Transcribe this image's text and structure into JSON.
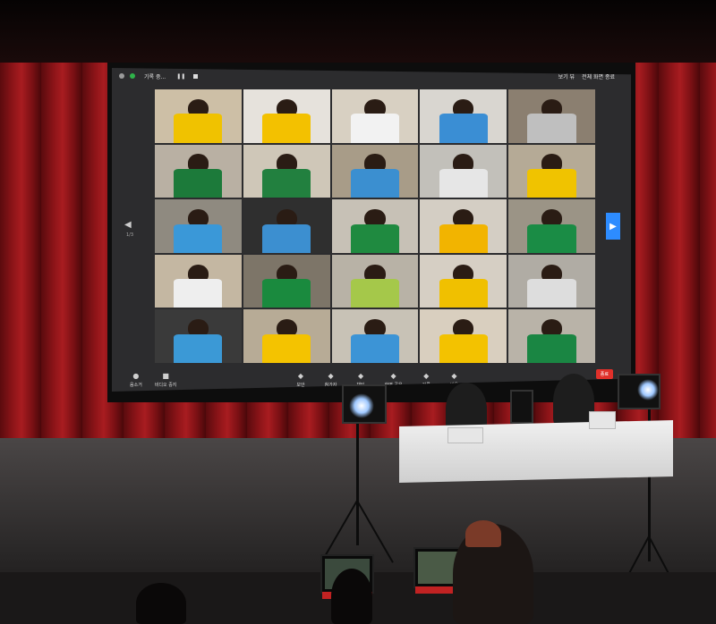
{
  "zoom": {
    "topbar": {
      "recording_label": "기록 중...",
      "right_label_1": "보기 뷰",
      "right_label_2": "전체 화면 종료"
    },
    "pager": {
      "left_arrow": "◀",
      "page": "1/3",
      "right_arrow": "▶"
    },
    "bottombar": {
      "audio_label": "음소거",
      "video_label": "비디오 중지",
      "center_items": [
        "보안",
        "참가자",
        "채팅",
        "화면 공유",
        "기록",
        "반응"
      ],
      "end_label": "종료"
    },
    "tiles": [
      {
        "bg": "#cdbfa6",
        "shirt": "#f0c200"
      },
      {
        "bg": "#e6e2dc",
        "shirt": "#f3c100"
      },
      {
        "bg": "#d8d0c2",
        "shirt": "#f2f2f2"
      },
      {
        "bg": "#d9d6d0",
        "shirt": "#3a8ed4"
      },
      {
        "bg": "#8b7f70",
        "shirt": "#bfbfbf"
      },
      {
        "bg": "#b9b0a3",
        "shirt": "#1c7a3a"
      },
      {
        "bg": "#cfc7b8",
        "shirt": "#22803f"
      },
      {
        "bg": "#a89c88",
        "shirt": "#3b8fd0"
      },
      {
        "bg": "#c2c0ba",
        "shirt": "#e6e6e6"
      },
      {
        "bg": "#b5aa96",
        "shirt": "#f0c300"
      },
      {
        "bg": "#8f8a80",
        "shirt": "#3a98d8"
      },
      {
        "bg": "#2f2f2f",
        "shirt": "#3c8fd0"
      },
      {
        "bg": "#c7c1b6",
        "shirt": "#1f8a40"
      },
      {
        "bg": "#d4cec4",
        "shirt": "#f2b400"
      },
      {
        "bg": "#9b9486",
        "shirt": "#1a8c45"
      },
      {
        "bg": "#c4b7a2",
        "shirt": "#eeeeee"
      },
      {
        "bg": "#7d7568",
        "shirt": "#1a8a3e"
      },
      {
        "bg": "#b8b2a6",
        "shirt": "#a5c84a"
      },
      {
        "bg": "#d6cfc4",
        "shirt": "#f0c000"
      },
      {
        "bg": "#b0aca4",
        "shirt": "#dddddd"
      },
      {
        "bg": "#3a3a3a",
        "shirt": "#3b99d6"
      },
      {
        "bg": "#b7ab96",
        "shirt": "#f4c300"
      },
      {
        "bg": "#c8c2b6",
        "shirt": "#3c94d6"
      },
      {
        "bg": "#d9cfbf",
        "shirt": "#f3c200"
      },
      {
        "bg": "#b9b3a8",
        "shirt": "#1a8643"
      }
    ]
  },
  "colors": {
    "curtain": "#8c1418",
    "zoom_blue": "#2d8cff",
    "zoom_end_red": "#e0302a"
  }
}
